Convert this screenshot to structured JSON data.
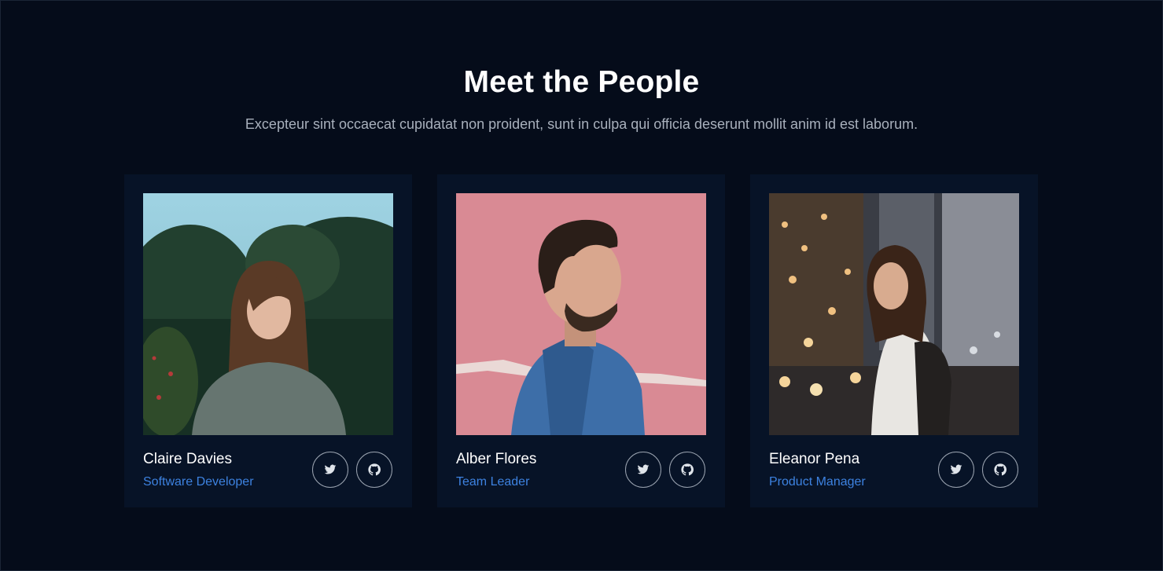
{
  "section": {
    "title": "Meet the People",
    "subtitle": "Excepteur sint occaecat cupidatat non proident, sunt in culpa qui officia deserunt mollit anim id est laborum."
  },
  "people": [
    {
      "name": "Claire Davies",
      "role": "Software Developer",
      "social": [
        "twitter-icon",
        "github-icon"
      ]
    },
    {
      "name": "Alber Flores",
      "role": "Team Leader",
      "social": [
        "twitter-icon",
        "github-icon"
      ]
    },
    {
      "name": "Eleanor Pena",
      "role": "Product Manager",
      "social": [
        "twitter-icon",
        "github-icon"
      ]
    }
  ],
  "colors": {
    "background": "#050c1a",
    "card": "#071327",
    "accent": "#3d82e0",
    "heading": "#ffffff",
    "muted": "#a8b0bc"
  }
}
